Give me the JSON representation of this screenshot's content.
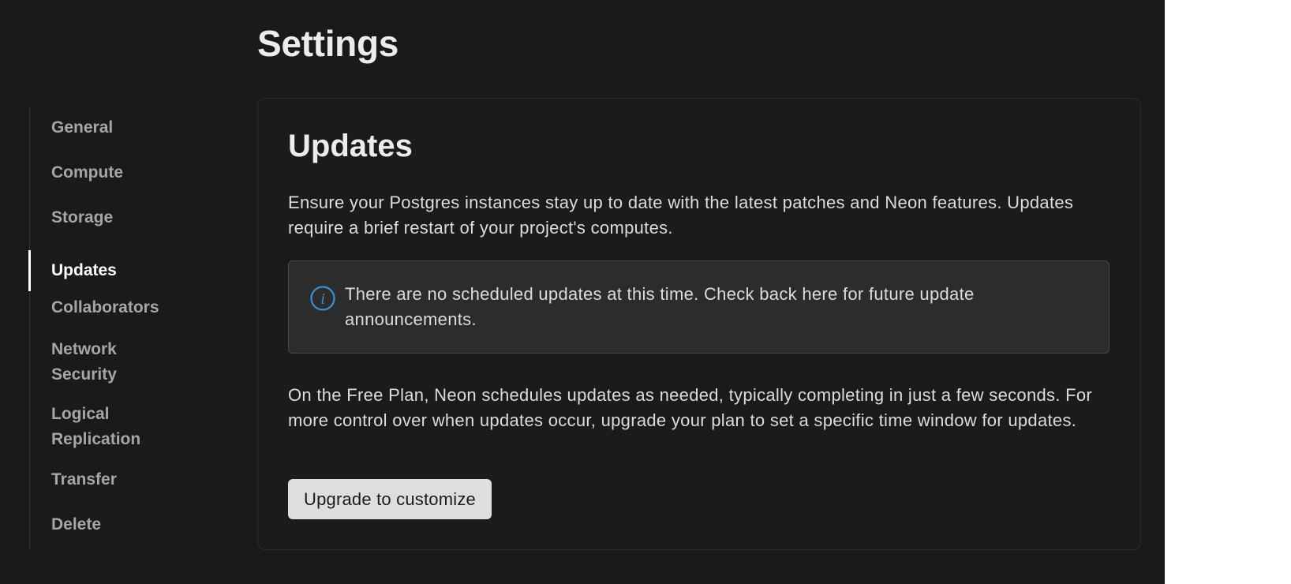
{
  "page": {
    "title": "Settings"
  },
  "sidebar": {
    "items": [
      {
        "label": "General"
      },
      {
        "label": "Compute"
      },
      {
        "label": "Storage"
      },
      {
        "label": "Updates",
        "active": true
      },
      {
        "label": "Collaborators"
      },
      {
        "label": "Network Security"
      },
      {
        "label": "Logical Replication"
      },
      {
        "label": "Transfer"
      },
      {
        "label": "Delete"
      }
    ]
  },
  "updates": {
    "title": "Updates",
    "description": "Ensure your Postgres instances stay up to date with the latest patches and Neon features. Updates require a brief restart of your project's computes.",
    "notice": {
      "icon": "info-icon",
      "text": "There are no scheduled updates at this time. Check back here for future update announcements."
    },
    "plan_text": "On the Free Plan, Neon schedules updates as needed, typically completing in just a few seconds. For more control over when updates occur, upgrade your plan to set a specific time window for updates.",
    "upgrade_button_label": "Upgrade to customize"
  },
  "colors": {
    "background": "#1a1a1a",
    "accent_info": "#3b8fdc",
    "button_bg": "#dedede"
  }
}
